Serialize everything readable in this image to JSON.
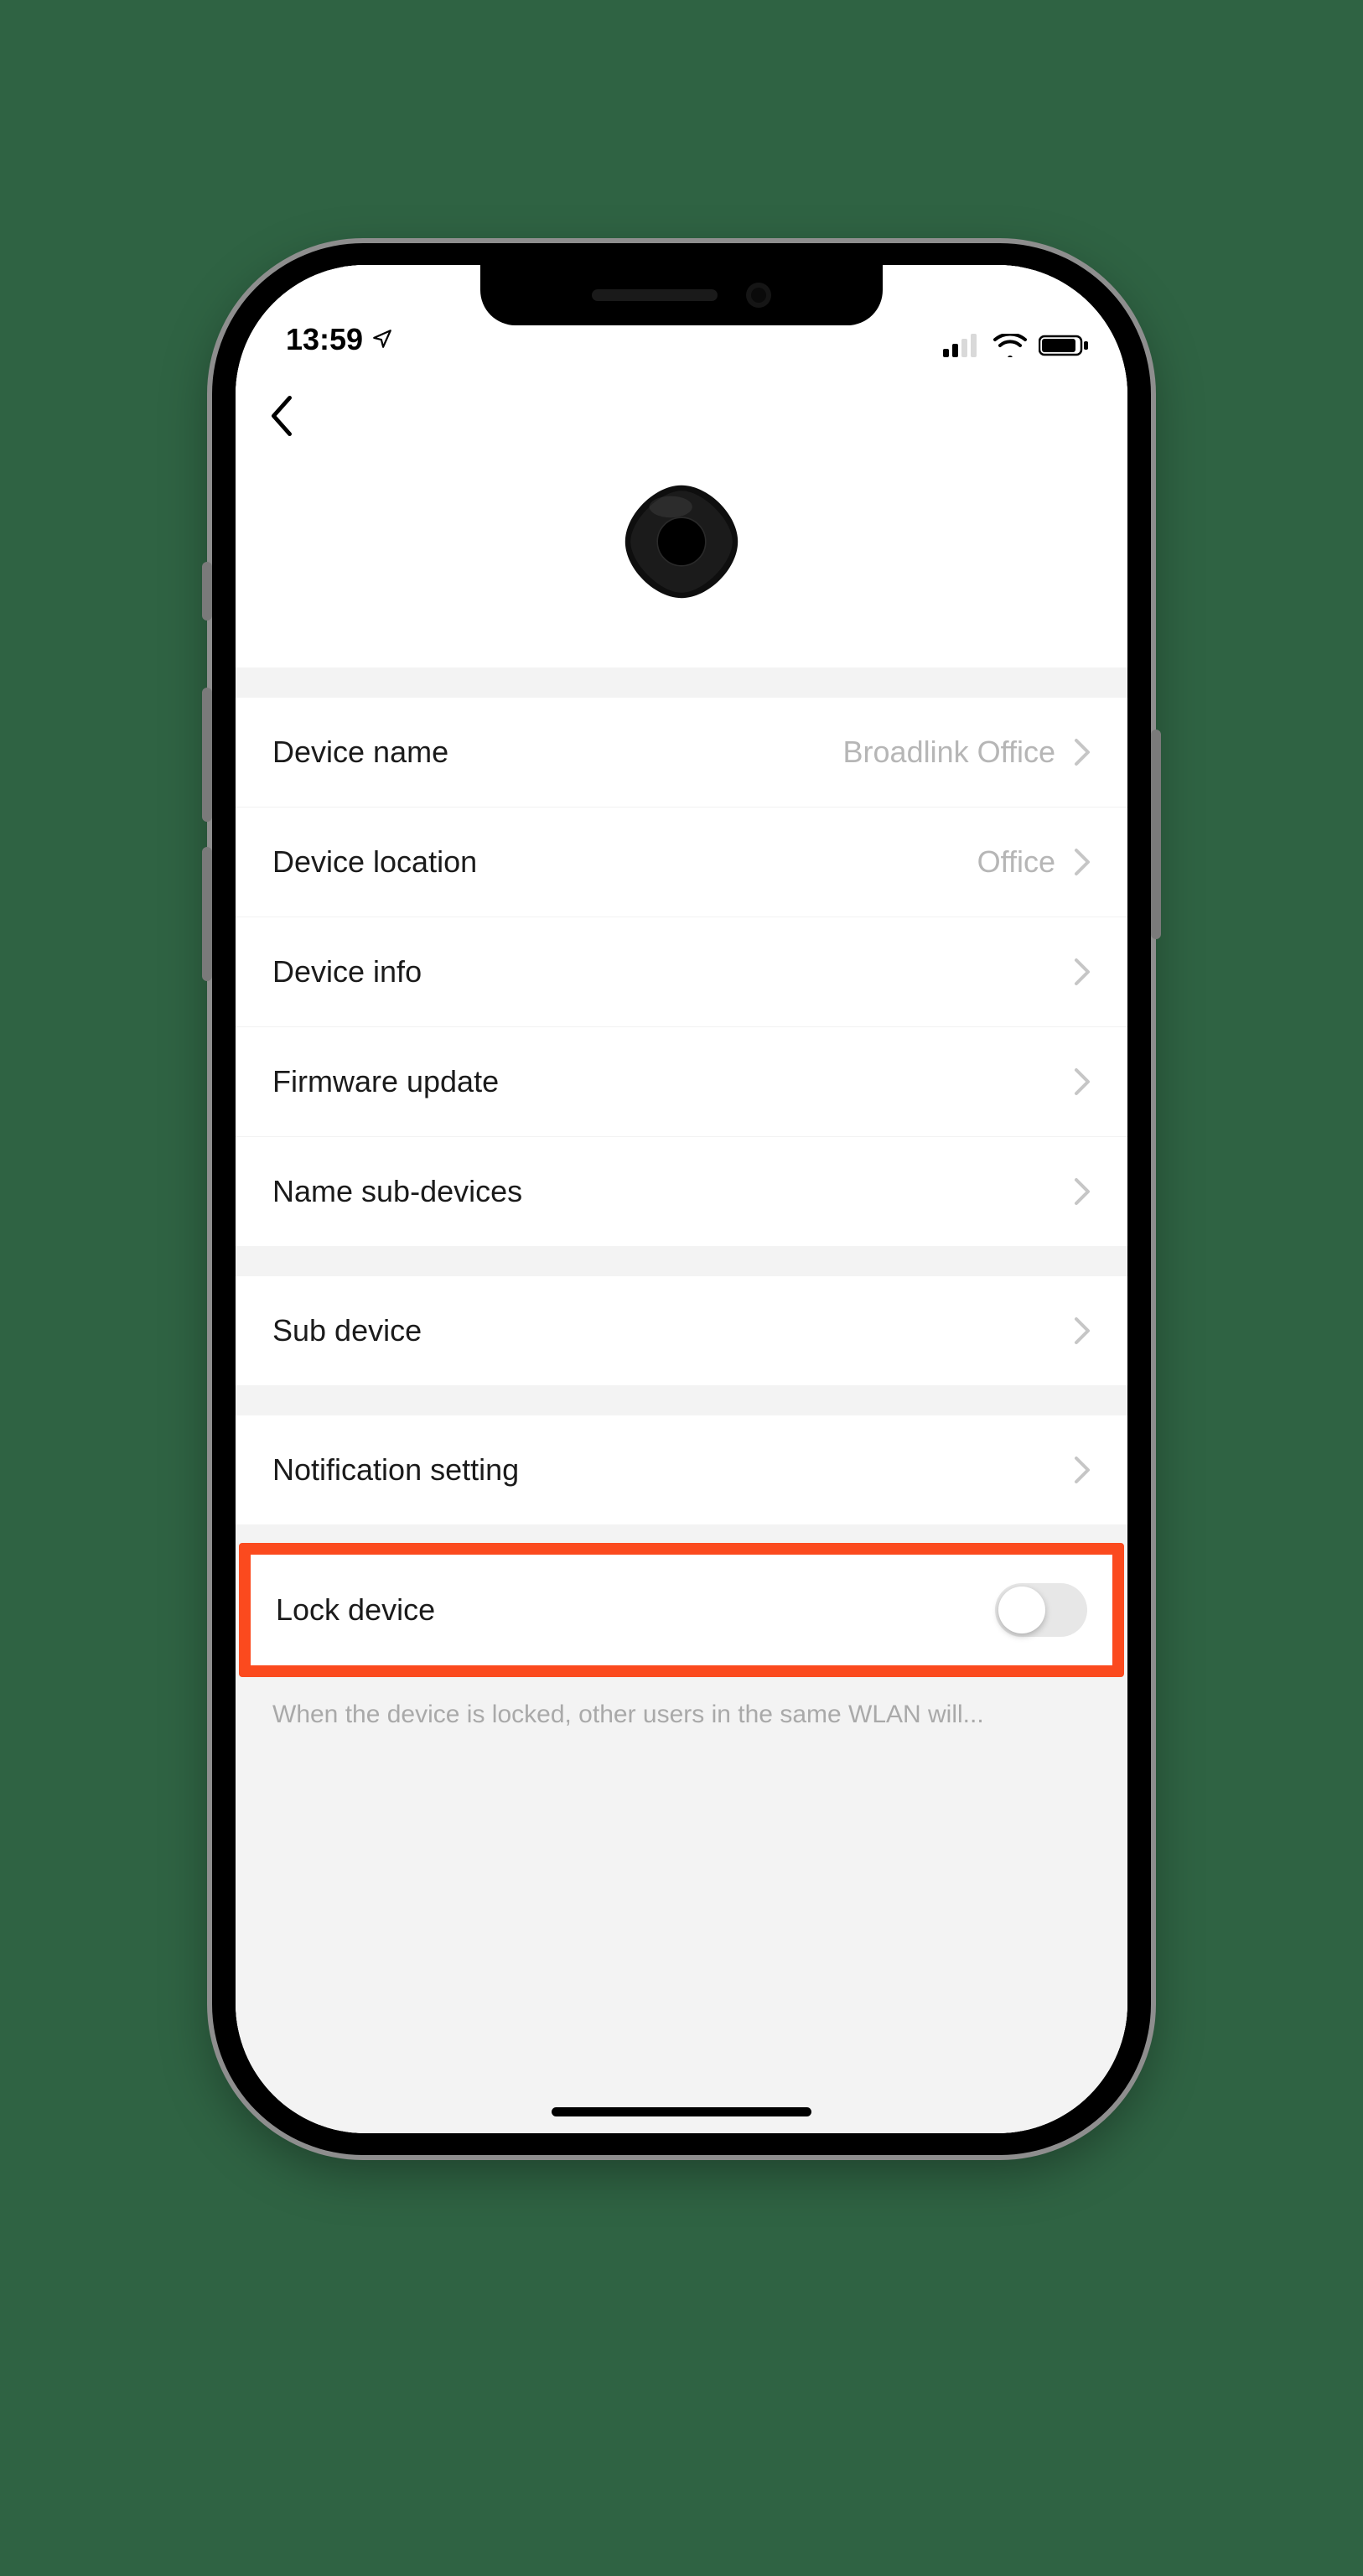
{
  "status": {
    "time": "13:59",
    "location_arrow": true
  },
  "settings": {
    "rows": [
      {
        "label": "Device name",
        "value": "Broadlink Office"
      },
      {
        "label": "Device location",
        "value": "Office"
      },
      {
        "label": "Device info",
        "value": ""
      },
      {
        "label": "Firmware update",
        "value": ""
      },
      {
        "label": "Name sub-devices",
        "value": ""
      }
    ],
    "sub_device": {
      "label": "Sub device"
    },
    "notification": {
      "label": "Notification setting"
    },
    "lock": {
      "label": "Lock device",
      "on": false
    },
    "lock_footer": "When the device is locked, other users in the same WLAN will..."
  }
}
